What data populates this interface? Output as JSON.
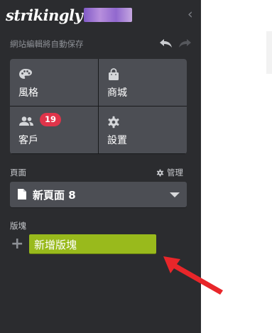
{
  "header": {
    "logo_text": "strikingly",
    "site_name_blurred": true,
    "collapse_icon": "chevron-left-icon",
    "autosave_text": "網站編輯將自動保存",
    "undo_icon": "undo-icon",
    "redo_icon": "redo-icon"
  },
  "menu": {
    "style": {
      "label": "風格",
      "icon": "palette-icon"
    },
    "store": {
      "label": "商城",
      "icon": "shopping-bag-icon"
    },
    "customers": {
      "label": "客戶",
      "icon": "users-icon",
      "badge": "19"
    },
    "settings": {
      "label": "設置",
      "icon": "gear-icon"
    }
  },
  "pages": {
    "section_label": "頁面",
    "manage_label": "管理",
    "current_page": "新頁面 8"
  },
  "blocks": {
    "section_label": "版塊",
    "add_block_label": "新增版塊"
  },
  "colors": {
    "sidebar_bg": "#2b2c2f",
    "tile_bg": "#4c4e54",
    "badge_red": "#e0344a",
    "add_block_green": "#99ba1c",
    "arrow_red": "#e8262a"
  }
}
